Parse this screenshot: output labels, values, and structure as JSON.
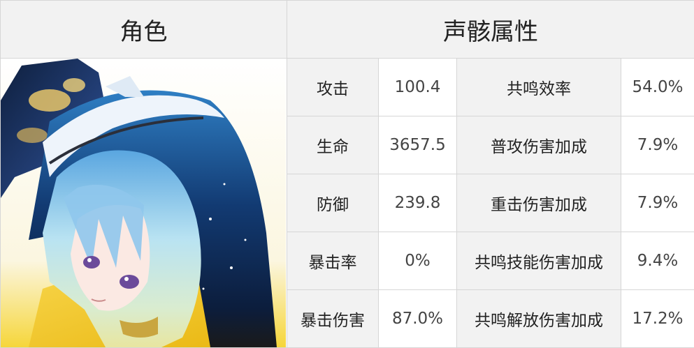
{
  "header": {
    "character_col": "角色",
    "echo_col": "声骸属性"
  },
  "rows": [
    {
      "stat": "攻击",
      "stat_value": "100.4",
      "bonus": "共鸣效率",
      "bonus_value": "54.0%"
    },
    {
      "stat": "生命",
      "stat_value": "3657.5",
      "bonus": "普攻伤害加成",
      "bonus_value": "7.9%"
    },
    {
      "stat": "防御",
      "stat_value": "239.8",
      "bonus": "重击伤害加成",
      "bonus_value": "7.9%"
    },
    {
      "stat": "暴击率",
      "stat_value": "0%",
      "bonus": "共鸣技能伤害加成",
      "bonus_value": "9.4%"
    },
    {
      "stat": "暴击伤害",
      "stat_value": "87.0%",
      "bonus": "共鸣解放伤害加成",
      "bonus_value": "17.2%"
    }
  ],
  "colors": {
    "header_bg": "#f2f2f2",
    "label_bg": "#f2f2f2",
    "border": "#d6d6d6"
  },
  "portrait": {
    "icon": "character-portrait",
    "hair_colors": [
      "#123a72",
      "#3f8fd0",
      "#b9e3f2",
      "#e8e6a0"
    ],
    "accent": "#f2c21c"
  }
}
